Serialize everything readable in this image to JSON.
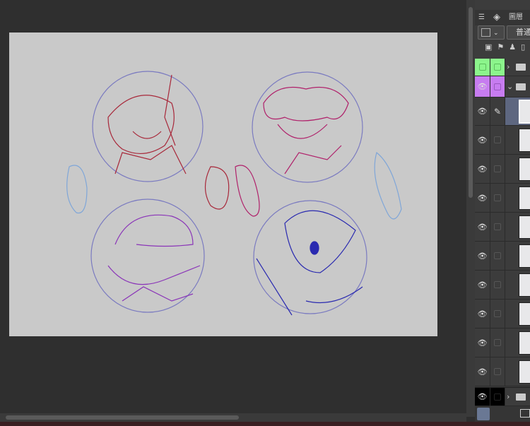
{
  "panel": {
    "tab_label": "圖層",
    "blend_mode": "普通",
    "layers": [
      {
        "type": "folder",
        "state": "collapsed",
        "color": "#8cf58c"
      },
      {
        "type": "folder",
        "state": "expanded",
        "color": "#c77cf0"
      },
      {
        "type": "layer",
        "selected": true
      },
      {
        "type": "layer"
      },
      {
        "type": "layer"
      },
      {
        "type": "layer"
      },
      {
        "type": "layer"
      },
      {
        "type": "layer"
      },
      {
        "type": "layer"
      },
      {
        "type": "layer"
      },
      {
        "type": "layer"
      },
      {
        "type": "layer"
      },
      {
        "type": "folder",
        "state": "collapsed",
        "color": "#000000"
      }
    ]
  },
  "colors": {
    "canvas": "#c9c9c9",
    "sketch_red": "#a8283a",
    "sketch_magenta": "#b0206a",
    "sketch_purple": "#8a34b8",
    "sketch_blue": "#2a2ab0",
    "sketch_lightblue": "#7fa6d8"
  }
}
